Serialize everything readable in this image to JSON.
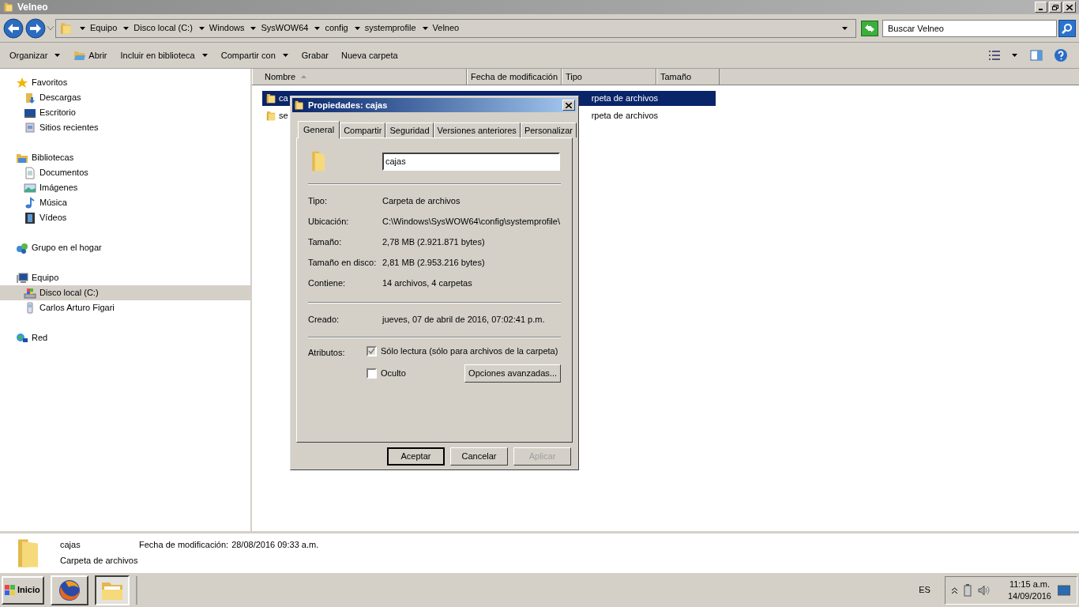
{
  "window": {
    "title": "Velneo"
  },
  "address": {
    "breadcrumb": [
      "Equipo",
      "Disco local (C:)",
      "Windows",
      "SysWOW64",
      "config",
      "systemprofile",
      "Velneo"
    ]
  },
  "search": {
    "placeholder": "Buscar Velneo"
  },
  "toolbar": [
    {
      "label": "Organizar",
      "kind": "menu"
    },
    {
      "label": "Abrir",
      "kind": "icon-button"
    },
    {
      "label": "Incluir en biblioteca",
      "kind": "menu"
    },
    {
      "label": "Compartir con",
      "kind": "menu"
    },
    {
      "label": "Grabar",
      "kind": "button"
    },
    {
      "label": "Nueva carpeta",
      "kind": "button"
    }
  ],
  "sidebar": {
    "groups": [
      {
        "label": "Favoritos",
        "selected": false,
        "children": [
          {
            "label": "Descargas",
            "selected": false
          },
          {
            "label": "Escritorio",
            "selected": false
          },
          {
            "label": "Sitios recientes",
            "selected": false
          }
        ]
      },
      {
        "label": "Bibliotecas",
        "selected": false,
        "children": [
          {
            "label": "Documentos",
            "selected": false
          },
          {
            "label": "Imágenes",
            "selected": false
          },
          {
            "label": "Música",
            "selected": false
          },
          {
            "label": "Vídeos",
            "selected": false
          }
        ]
      },
      {
        "label": "Grupo en el hogar",
        "selected": false
      },
      {
        "label": "Equipo",
        "selected": false,
        "children": [
          {
            "label": "Disco local (C:)",
            "selected": true
          },
          {
            "label": "Carlos Arturo Figari",
            "selected": false
          }
        ]
      },
      {
        "label": "Red",
        "selected": false
      }
    ]
  },
  "table": {
    "columns": [
      {
        "label": "Nombre",
        "sorted": true
      },
      {
        "label": "Fecha de modificación",
        "sorted": false
      },
      {
        "label": "Tipo",
        "sorted": false
      },
      {
        "label": "Tamaño",
        "sorted": false
      }
    ],
    "rows": [
      {
        "name": "ca",
        "type": "rpeta de archivos",
        "selected": true
      },
      {
        "name": "se",
        "type": "rpeta de archivos",
        "selected": false
      }
    ]
  },
  "dialog": {
    "title": "Propiedades: cajas",
    "tabs": [
      {
        "label": "General",
        "selected": true
      },
      {
        "label": "Compartir",
        "selected": false
      },
      {
        "label": "Seguridad",
        "selected": false
      },
      {
        "label": "Versiones anteriores",
        "selected": false
      },
      {
        "label": "Personalizar",
        "selected": false
      }
    ],
    "name_value": "cajas",
    "sections": [
      [
        {
          "label": "Tipo:",
          "value": "Carpeta de archivos"
        },
        {
          "label": "Ubicación:",
          "value": "C:\\Windows\\SysWOW64\\config\\systemprofile\\"
        },
        {
          "label": "Tamaño:",
          "value": "2,78 MB (2.921.871 bytes)"
        },
        {
          "label": "Tamaño en disco:",
          "value": "2,81 MB (2.953.216 bytes)"
        },
        {
          "label": "Contiene:",
          "value": "14 archivos, 4 carpetas"
        }
      ],
      [
        {
          "label": "Creado:",
          "value": "jueves, 07 de abril de 2016, 07:02:41 p.m."
        }
      ]
    ],
    "attributes_label": "Atributos:",
    "attributes": [
      {
        "label": "Sólo lectura (sólo para archivos de la carpeta)",
        "checked": true,
        "disabled": true
      },
      {
        "label": "Oculto",
        "checked": false,
        "disabled": false
      }
    ],
    "advanced_button": "Opciones avanzadas...",
    "buttons": [
      {
        "label": "Aceptar",
        "kind": "default"
      },
      {
        "label": "Cancelar",
        "kind": "normal"
      },
      {
        "label": "Aplicar",
        "kind": "disabled"
      }
    ]
  },
  "details": {
    "name": "cajas",
    "type": "Carpeta de archivos",
    "modified_label": "Fecha de modificación:",
    "modified": "28/08/2016 09:33 a.m."
  },
  "taskbar": {
    "start": "Inicio",
    "language": "ES",
    "time": "11:15 a.m.",
    "date": "14/09/2016"
  }
}
